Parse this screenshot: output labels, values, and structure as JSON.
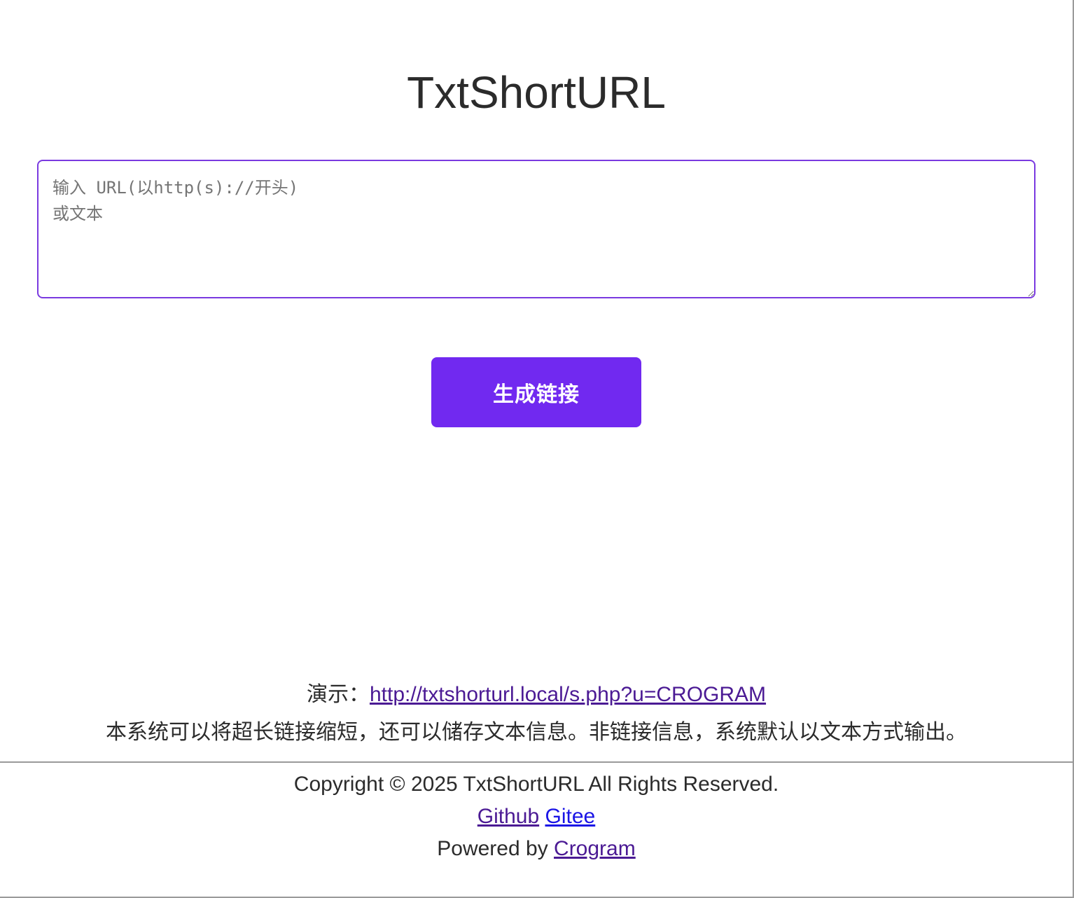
{
  "header": {
    "title": "TxtShortURL"
  },
  "form": {
    "input_placeholder": "输入 URL(以http(s)://开头)\n或文本",
    "input_value": "",
    "generate_label": "生成链接"
  },
  "info": {
    "demo_prefix": "演示：",
    "demo_link": "http://txtshorturl.local/s.php?u=CROGRAM",
    "description": "本系统可以将超长链接缩短，还可以储存文本信息。非链接信息，系统默认以文本方式输出。"
  },
  "footer": {
    "copyright": "Copyright © 2025 TxtShortURL All Rights Reserved.",
    "github_label": "Github",
    "gitee_label": "Gitee",
    "powered_prefix": "Powered by ",
    "powered_link": "Crogram"
  },
  "colors": {
    "accent": "#7129f0",
    "input_border": "#7a3ae0",
    "visited_link": "#4b1a94",
    "link": "#1a14e6"
  }
}
